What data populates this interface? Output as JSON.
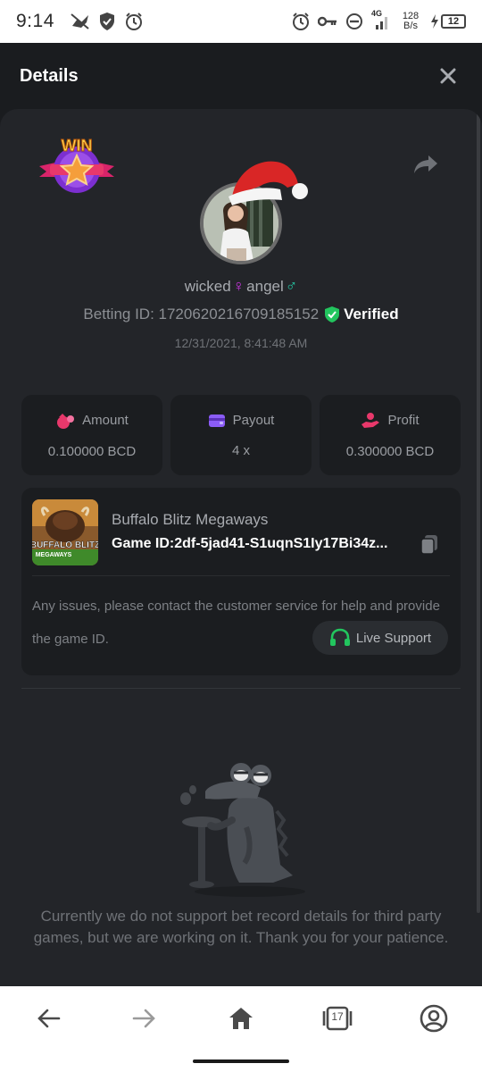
{
  "status_bar": {
    "time": "9:14",
    "network_type": "4G",
    "speed_value": "128",
    "speed_unit": "B/s",
    "battery_level": "12",
    "icons": [
      "bird-icon",
      "shield-check-icon",
      "alarm-icon",
      "alarm-icon",
      "key-icon",
      "dnd-icon",
      "signal-icon",
      "battery-charging-icon"
    ]
  },
  "header": {
    "title": "Details",
    "close_icon": "close-icon"
  },
  "profile": {
    "badge_text": "WIN",
    "username_part1": "wicked",
    "username_female_symbol": "♀",
    "username_part2": "angel",
    "username_male_symbol": "♂",
    "betting_id": "Betting ID: 1720620216709185152",
    "verified_label": "Verified",
    "datetime": "12/31/2021, 8:41:48 AM"
  },
  "stats": [
    {
      "label": "Amount",
      "value": "0.100000 BCD",
      "icon": "money-bag-icon",
      "color": "#e8386b"
    },
    {
      "label": "Payout",
      "value": "4 x",
      "icon": "wallet-icon",
      "color": "#8b5cf6"
    },
    {
      "label": "Profit",
      "value": "0.300000 BCD",
      "icon": "hand-coin-icon",
      "color": "#e8386b"
    }
  ],
  "game": {
    "name": "Buffalo Blitz Megaways",
    "game_id": "Game ID:2df-5jad41-S1uqnS1Iy17Bi34z...",
    "thumb_title": "BUFFALO BLITZ",
    "thumb_subtitle": "MEGAWAYS",
    "issue_text": "Any issues, please contact the customer service for help and provide the game ID.",
    "live_support_label": "Live Support"
  },
  "notice": "Currently we do not support bet record details for third party games, but we are working on it. Thank you for your patience.",
  "navbar": {
    "tab_count": "17"
  },
  "colors": {
    "background": "#1a1c1f",
    "card": "#232529",
    "verified_green": "#22c55e",
    "accent_pink": "#e8386b",
    "accent_purple": "#8b5cf6",
    "support_green": "#22c55e"
  }
}
